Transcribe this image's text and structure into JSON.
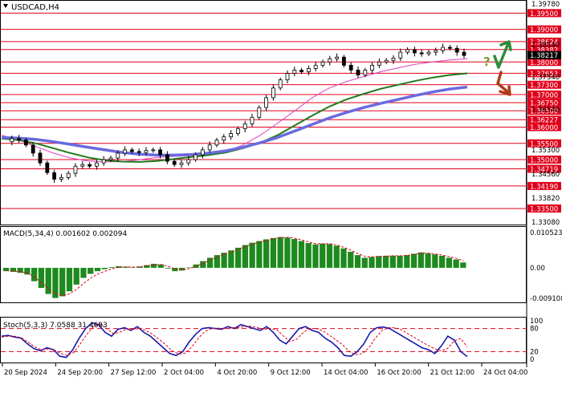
{
  "window": {
    "symbol": "USDCAD,H4"
  },
  "colors": {
    "background": "#ffffff",
    "level_line": "#e0001b",
    "level_box": "#e0001b",
    "ma_fast": "#e040c0",
    "ma_mid": "#1e7a1e",
    "ma_slow": "#6a6ae0",
    "macd_bar": "#1e8a1e",
    "macd_signal": "#e0001b",
    "stoch_main": "#1a1aa8",
    "stoch_signal": "#e0001b",
    "up_arrow": "#2e8b3a",
    "down_arrow": "#b03a1a",
    "question": "#7a9a30",
    "candle": "#000000",
    "axis_text": "#000000"
  },
  "annotations": {
    "question_mark": "?"
  },
  "chart_data": [
    {
      "type": "candlestick",
      "title": "USDCAD,H4",
      "ylim": [
        1.3308,
        1.3978
      ],
      "price_scale_ticks": [
        "1.39780",
        "1.38540",
        "1.37540",
        "1.36540",
        "1.35300",
        "1.34560",
        "1.33820",
        "1.33080"
      ],
      "levels": [
        {
          "price": 1.395,
          "label": "1.39500"
        },
        {
          "price": 1.39,
          "label": "1.39000"
        },
        {
          "price": 1.38624,
          "label": "1.38624"
        },
        {
          "price": 1.38382,
          "label": "1.38382"
        },
        {
          "price": 1.38,
          "label": "1.38000"
        },
        {
          "price": 1.37653,
          "label": "1.37653"
        },
        {
          "price": 1.373,
          "label": "1.37300"
        },
        {
          "price": 1.37,
          "label": "1.37000"
        },
        {
          "price": 1.3675,
          "label": "1.36750"
        },
        {
          "price": 1.365,
          "label": "1.36500"
        },
        {
          "price": 1.36227,
          "label": "1.36227"
        },
        {
          "price": 1.36,
          "label": "1.36000"
        },
        {
          "price": 1.355,
          "label": "1.35500"
        },
        {
          "price": 1.35,
          "label": "1.35000"
        },
        {
          "price": 1.34719,
          "label": "1.34719"
        },
        {
          "price": 1.3419,
          "label": "1.34190"
        },
        {
          "price": 1.335,
          "label": "1.33500"
        }
      ],
      "current_price": {
        "price": 1.3821,
        "label": "1.38217"
      },
      "price_path": [
        1.3555,
        1.3565,
        1.356,
        1.3545,
        1.352,
        1.349,
        1.346,
        1.344,
        1.3445,
        1.3458,
        1.348,
        1.3485,
        1.348,
        1.349,
        1.35,
        1.3505,
        1.352,
        1.353,
        1.3525,
        1.3522,
        1.3528,
        1.353,
        1.3515,
        1.3495,
        1.3485,
        1.349,
        1.35,
        1.3515,
        1.353,
        1.3545,
        1.356,
        1.357,
        1.358,
        1.3595,
        1.361,
        1.363,
        1.366,
        1.369,
        1.372,
        1.3745,
        1.3765,
        1.3775,
        1.377,
        1.378,
        1.379,
        1.38,
        1.381,
        1.3815,
        1.379,
        1.3775,
        1.376,
        1.3775,
        1.379,
        1.38,
        1.3805,
        1.3812,
        1.383,
        1.3838,
        1.3828,
        1.3825,
        1.383,
        1.3835,
        1.3845,
        1.3842,
        1.383,
        1.382
      ],
      "moving_averages": [
        {
          "name": "MA fast",
          "values": [
            1.3575,
            1.356,
            1.354,
            1.352,
            1.3505,
            1.3496,
            1.3493,
            1.3494,
            1.35,
            1.3507,
            1.351,
            1.3512,
            1.3515,
            1.3525,
            1.3545,
            1.3575,
            1.3612,
            1.365,
            1.369,
            1.372,
            1.374,
            1.3755,
            1.377,
            1.3782,
            1.3793,
            1.38,
            1.3806,
            1.381
          ]
        },
        {
          "name": "MA mid",
          "values": [
            1.3565,
            1.356,
            1.355,
            1.3535,
            1.352,
            1.3507,
            1.3498,
            1.3494,
            1.3493,
            1.3496,
            1.3502,
            1.3508,
            1.3514,
            1.3522,
            1.3535,
            1.3552,
            1.3575,
            1.3605,
            1.3635,
            1.3663,
            1.3685,
            1.3702,
            1.3718,
            1.373,
            1.3742,
            1.3752,
            1.376,
            1.3765
          ]
        },
        {
          "name": "MA slow",
          "values": [
            1.3568,
            1.3566,
            1.3562,
            1.3555,
            1.3547,
            1.3538,
            1.353,
            1.3522,
            1.3517,
            1.3514,
            1.3514,
            1.3516,
            1.352,
            1.3527,
            1.3538,
            1.3552,
            1.3568,
            1.3588,
            1.3608,
            1.3628,
            1.3645,
            1.366,
            1.3673,
            1.3685,
            1.3697,
            1.3708,
            1.3717,
            1.3723
          ]
        }
      ]
    },
    {
      "type": "bar",
      "title": "MACD(5,34,4) 0.001602 0.002094",
      "ylim": [
        -0.009108,
        0.010523
      ],
      "ticks": [
        "0.010523",
        "0.00",
        "-0.009108"
      ],
      "values": [
        -0.001,
        -0.0012,
        -0.0015,
        -0.002,
        -0.004,
        -0.006,
        -0.0078,
        -0.009,
        -0.0085,
        -0.007,
        -0.005,
        -0.003,
        -0.0018,
        -0.001,
        -0.0004,
        0.0002,
        0.0005,
        0.0003,
        0.0001,
        0.0004,
        0.0008,
        0.0012,
        0.001,
        -0.0002,
        -0.001,
        -0.0008,
        0.0001,
        0.001,
        0.002,
        0.003,
        0.0038,
        0.0045,
        0.0052,
        0.006,
        0.0068,
        0.0075,
        0.008,
        0.0085,
        0.0089,
        0.0092,
        0.009,
        0.0086,
        0.008,
        0.0074,
        0.007,
        0.0072,
        0.0071,
        0.0066,
        0.0058,
        0.0048,
        0.0038,
        0.003,
        0.0032,
        0.0035,
        0.0036,
        0.0036,
        0.0036,
        0.0038,
        0.0042,
        0.0046,
        0.0043,
        0.004,
        0.0036,
        0.003,
        0.0025,
        0.0016
      ],
      "signal": [
        -0.0008,
        -0.001,
        -0.0012,
        -0.0016,
        -0.0028,
        -0.0045,
        -0.0063,
        -0.0078,
        -0.0083,
        -0.0077,
        -0.0063,
        -0.0045,
        -0.003,
        -0.0018,
        -0.001,
        -0.0003,
        0.0002,
        0.0003,
        0.0002,
        0.0003,
        0.0006,
        0.0009,
        0.001,
        0.0004,
        -0.0004,
        -0.0006,
        -0.0002,
        0.0005,
        0.0014,
        0.0024,
        0.0033,
        0.0041,
        0.0048,
        0.0056,
        0.0064,
        0.0071,
        0.0077,
        0.0082,
        0.0087,
        0.009,
        0.0091,
        0.0088,
        0.0083,
        0.0077,
        0.0072,
        0.0072,
        0.0072,
        0.0068,
        0.0061,
        0.0052,
        0.0042,
        0.0034,
        0.0033,
        0.0034,
        0.0035,
        0.0036,
        0.0036,
        0.0037,
        0.004,
        0.0044,
        0.0044,
        0.0041,
        0.0038,
        0.0033,
        0.0028,
        0.0021
      ]
    },
    {
      "type": "line",
      "title": "Stoch(5,3,3) 7.0588 31.4693",
      "ylim": [
        0,
        100
      ],
      "ticks": [
        "100",
        "80",
        "20",
        "0"
      ],
      "levels": [
        80,
        20
      ],
      "series": [
        {
          "values": [
            60,
            62,
            58,
            55,
            40,
            28,
            22,
            30,
            25,
            8,
            5,
            25,
            55,
            80,
            95,
            90,
            70,
            60,
            78,
            82,
            75,
            85,
            70,
            60,
            45,
            30,
            15,
            10,
            20,
            45,
            65,
            80,
            82,
            80,
            78,
            85,
            80,
            90,
            85,
            80,
            75,
            85,
            70,
            50,
            40,
            60,
            80,
            85,
            75,
            70,
            55,
            45,
            30,
            10,
            8,
            20,
            40,
            70,
            82,
            84,
            80,
            70,
            60,
            50,
            40,
            30,
            25,
            15,
            35,
            60,
            50,
            20,
            7
          ]
        },
        {
          "values": [
            58,
            60,
            60,
            56,
            45,
            33,
            25,
            27,
            25,
            15,
            10,
            18,
            40,
            65,
            85,
            92,
            80,
            67,
            70,
            78,
            78,
            80,
            75,
            65,
            52,
            38,
            22,
            14,
            16,
            32,
            55,
            72,
            80,
            81,
            80,
            82,
            82,
            85,
            86,
            82,
            78,
            80,
            76,
            60,
            46,
            52,
            70,
            80,
            80,
            74,
            62,
            50,
            38,
            20,
            12,
            15,
            30,
            55,
            75,
            82,
            82,
            76,
            66,
            56,
            46,
            36,
            28,
            22,
            28,
            48,
            54,
            32
          ]
        }
      ]
    }
  ],
  "time_labels": [
    "20 Sep 2024",
    "24 Sep 20:00",
    "27 Sep 12:00",
    "2 Oct 04:00",
    "4 Oct 20:00",
    "9 Oct 12:00",
    "14 Oct 04:00",
    "16 Oct 20:00",
    "21 Oct 12:00",
    "24 Oct 04:00"
  ]
}
